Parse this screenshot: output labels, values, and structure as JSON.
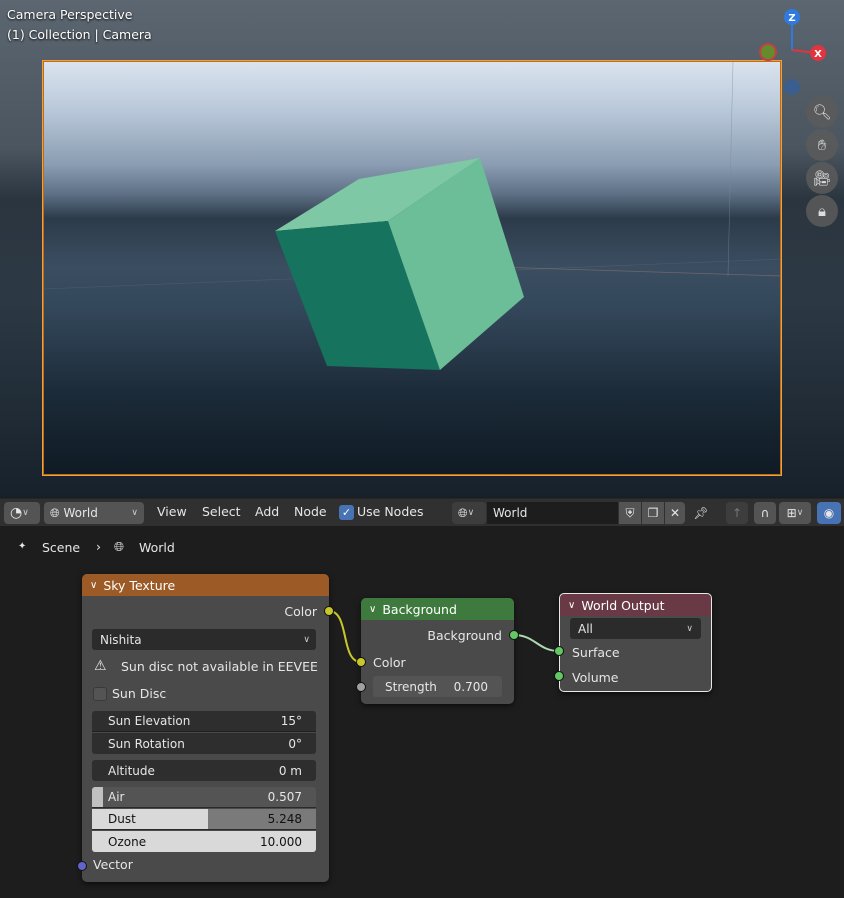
{
  "viewport": {
    "mode_label": "Camera Perspective",
    "collection_label": "(1) Collection | Camera",
    "gizmo": {
      "z": "Z",
      "x": "X"
    }
  },
  "header": {
    "editor_type_icon": "node-editor-icon",
    "shader_type": "World",
    "menus": [
      "View",
      "Select",
      "Add",
      "Node"
    ],
    "use_nodes_label": "Use Nodes",
    "use_nodes_checked": true,
    "world_datablock": "World"
  },
  "breadcrumb": {
    "scene": "Scene",
    "world": "World"
  },
  "nodes": {
    "sky": {
      "title": "Sky Texture",
      "output_color": "Color",
      "sky_type": "Nishita",
      "warning": "Sun disc not available in EEVEE",
      "sun_disc_label": "Sun Disc",
      "sun_elevation_label": "Sun Elevation",
      "sun_elevation": "15°",
      "sun_rotation_label": "Sun Rotation",
      "sun_rotation": "0°",
      "altitude_label": "Altitude",
      "altitude": "0 m",
      "air_label": "Air",
      "air": "0.507",
      "air_fraction": 0.05,
      "dust_label": "Dust",
      "dust": "5.248",
      "dust_fraction": 0.52,
      "ozone_label": "Ozone",
      "ozone": "10.000",
      "input_vector": "Vector"
    },
    "background": {
      "title": "Background",
      "output": "Background",
      "input_color": "Color",
      "strength_label": "Strength",
      "strength": "0.700"
    },
    "output": {
      "title": "World Output",
      "target": "All",
      "input_surface": "Surface",
      "input_volume": "Volume"
    }
  },
  "colors": {
    "sky_header": "#9b5a26",
    "background_header": "#3e7a3e",
    "output_header": "#693a45",
    "socket_color": "#c7c729",
    "socket_shader": "#63c763",
    "socket_vector": "#6363c7",
    "accent": "#4772b3"
  }
}
